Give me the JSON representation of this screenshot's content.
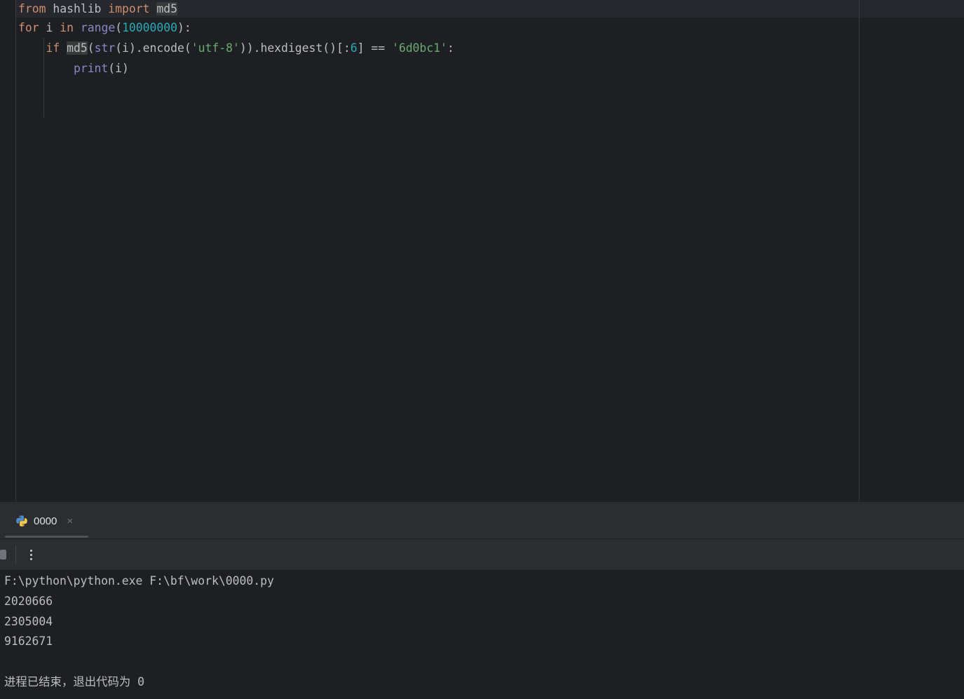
{
  "editor": {
    "lines": [
      {
        "t1": "from",
        "t2": " hashlib ",
        "t3": "import",
        "t4": " ",
        "t5": "md5"
      },
      {
        "t1": "for",
        "t2": " i ",
        "t3": "in",
        "t4": " ",
        "t5": "range",
        "t6": "(",
        "t7": "10000000",
        "t8": "):"
      },
      {
        "t0": "    ",
        "t1": "if",
        "t2": " ",
        "t3": "md5",
        "t4": "(",
        "t5": "str",
        "t6": "(i).encode(",
        "t7": "'utf-8'",
        "t8": ")).hexdigest()[:",
        "t9": "6",
        "t10": "] == ",
        "t11": "'6d0bc1'",
        "t12": ":"
      },
      {
        "t0": "        ",
        "t1": "print",
        "t2": "(i)"
      }
    ]
  },
  "run_panel": {
    "tab_label": "0000",
    "close_glyph": "×",
    "icons": {
      "tab": "python-icon",
      "stop": "stop-icon",
      "more": "more-vertical-icon"
    }
  },
  "console": {
    "lines": [
      "F:\\python\\python.exe F:\\bf\\work\\0000.py",
      "2020666",
      "2305004",
      "9162671",
      "",
      "进程已结束，退出代码为 0"
    ]
  },
  "colors": {
    "keyword": "#cf8e6d",
    "builtin": "#8888c6",
    "number": "#2aacb8",
    "string": "#6aab73",
    "text": "#bcbec4",
    "background": "#1e1f22",
    "panel": "#2b2d30"
  }
}
